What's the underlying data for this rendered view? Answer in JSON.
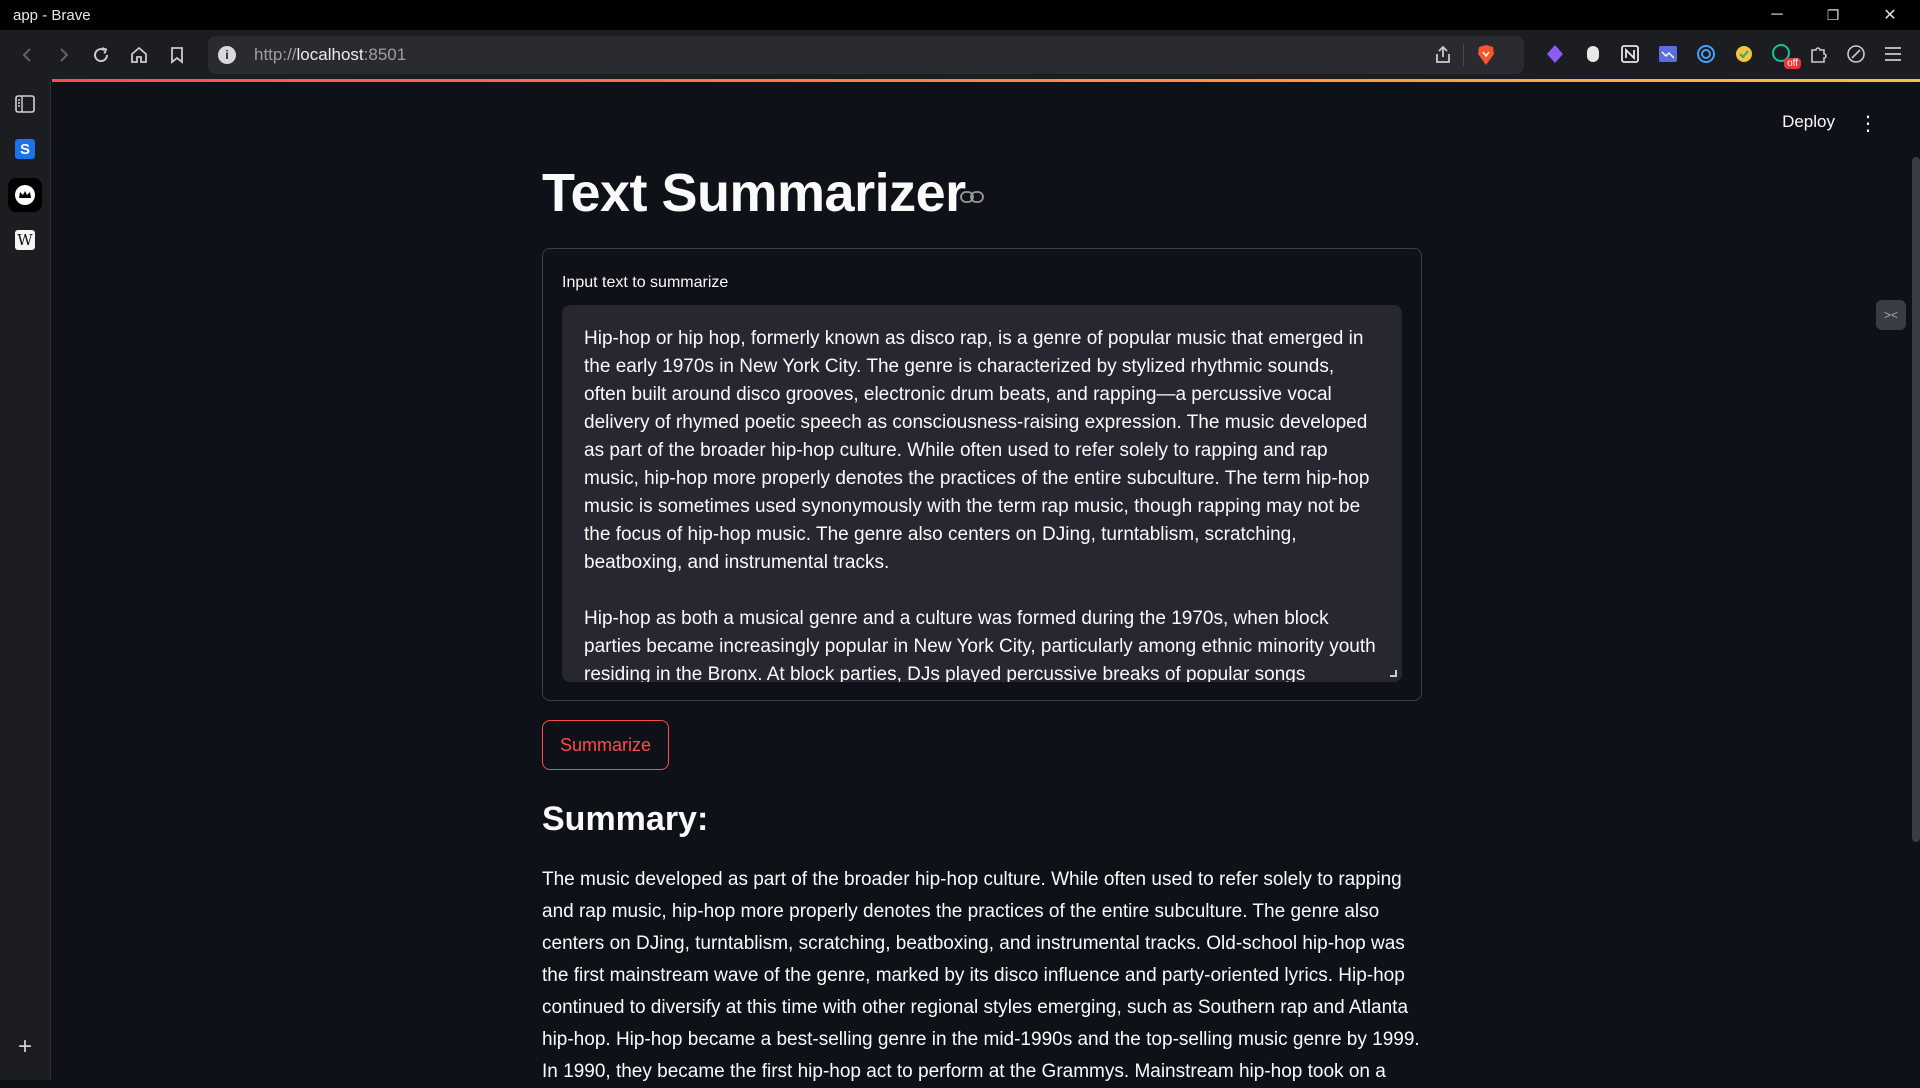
{
  "window": {
    "title": "app - Brave",
    "controls": {
      "minimize": "─",
      "restore": "❐",
      "close": "✕"
    }
  },
  "browser": {
    "url_scheme": "http://",
    "url_host": "localhost",
    "url_rest": ":8501",
    "extensions": [
      "obsidian-icon",
      "mouse-icon",
      "notion-icon",
      "image-icon",
      "target-icon",
      "palette-icon",
      "grammarly-off-icon",
      "puzzle-icon",
      "leaf-icon",
      "menu-icon"
    ],
    "ext_badge": "off",
    "sidebar_items": [
      "sidebar-toggle-icon",
      "s-app-icon",
      "crown-app-icon",
      "wikipedia-icon",
      "add-icon"
    ],
    "sidebar_wiki_label": "W",
    "sidebar_s_label": "S",
    "sidebar_add_label": "+"
  },
  "streamlit": {
    "deploy_label": "Deploy",
    "menu_glyph": "⋮"
  },
  "page": {
    "title": "Text Summarizer",
    "form": {
      "label": "Input text to summarize",
      "value": "Hip-hop or hip hop, formerly known as disco rap, is a genre of popular music that emerged in the early 1970s in New York City. The genre is characterized by stylized rhythmic sounds, often built around disco grooves, electronic drum beats, and rapping—a percussive vocal delivery of rhymed poetic speech as consciousness-raising expression. The music developed as part of the broader hip-hop culture. While often used to refer solely to rapping and rap music, hip-hop more properly denotes the practices of the entire subculture. The term hip-hop music is sometimes used synonymously with the term rap music, though rapping may not be the focus of hip-hop music. The genre also centers on DJing, turntablism, scratching, beatboxing, and instrumental tracks.\n\nHip-hop as both a musical genre and a culture was formed during the 1970s, when block parties became increasingly popular in New York City, particularly among ethnic minority youth residing in the Bronx. At block parties, DJs played percussive breaks of popular songs"
    },
    "button_label": "Summarize",
    "summary_heading": "Summary:",
    "summary_text": "The music developed as part of the broader hip-hop culture. While often used to refer solely to rapping and rap music, hip-hop more properly denotes the practices of the entire subculture. The genre also centers on DJing, turntablism, scratching, beatboxing, and instrumental tracks. Old-school hip-hop was the first mainstream wave of the genre, marked by its disco influence and party-oriented lyrics. Hip-hop continued to diversify at this time with other regional styles emerging, such as Southern rap and Atlanta hip-hop. Hip-hop became a best-selling genre in the mid-1990s and the top-selling music genre by 1999. In 1990, they became the first hip-hop act to perform at the Grammys. Mainstream hip-hop took on a"
  },
  "colors": {
    "accent": "#ff4b4b",
    "background": "#0e1117",
    "input_bg": "#262730"
  }
}
